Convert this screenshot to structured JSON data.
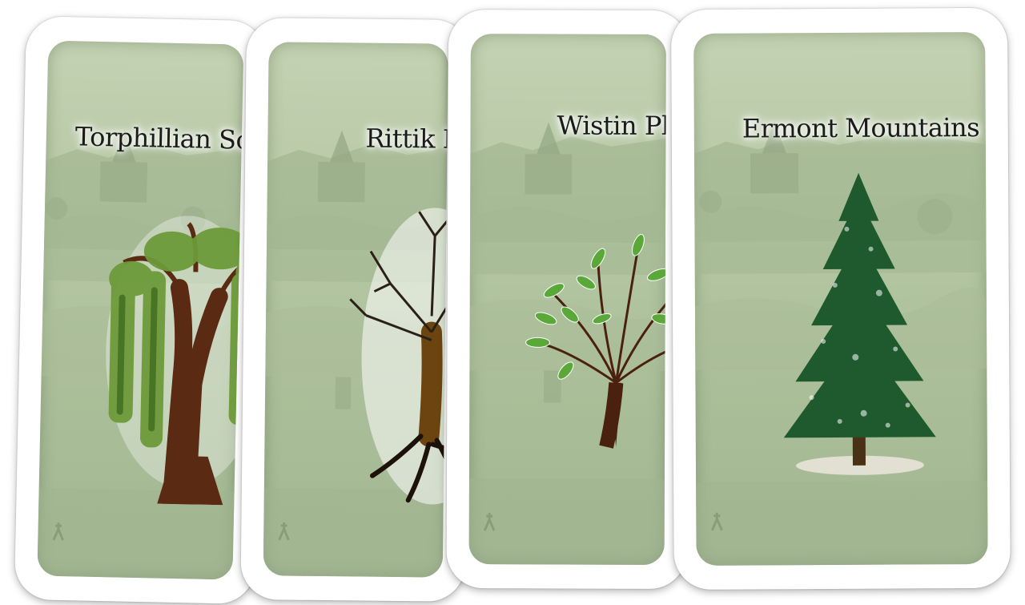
{
  "cards": [
    {
      "title": "Torphillian Scrub",
      "tree": "willow-tree-icon"
    },
    {
      "title": "Rittik Barrens",
      "tree": "bare-tree-icon"
    },
    {
      "title": "Wistin Plains",
      "tree": "leafy-sapling-icon"
    },
    {
      "title": "Ermont Mountains",
      "tree": "pine-tree-icon"
    }
  ],
  "colors": {
    "card_border": "#ffffff",
    "card_face": "#b6c8a5",
    "trunk": "#5a2a12",
    "willow_leaves": "#6d9a3a",
    "pine": "#1e5a2e",
    "sapling_leaves": "#5aa838"
  }
}
